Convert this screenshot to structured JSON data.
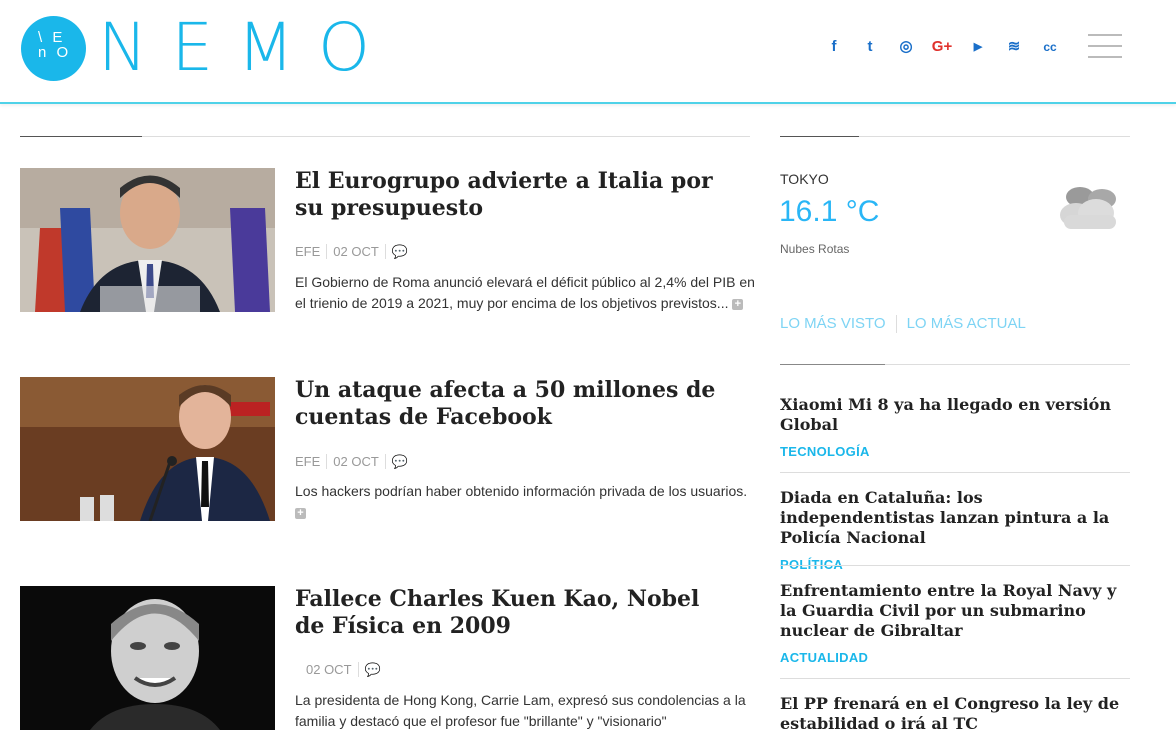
{
  "header": {
    "logo_mark": "\\ E\nn O",
    "logo_word": "NEMO",
    "social": [
      {
        "icon": "facebook-icon",
        "glyph": "f"
      },
      {
        "icon": "twitter-icon",
        "glyph": "t"
      },
      {
        "icon": "instagram-icon",
        "glyph": "◎"
      },
      {
        "icon": "google-plus-icon",
        "glyph": "G+"
      },
      {
        "icon": "youtube-icon",
        "glyph": "▶"
      },
      {
        "icon": "rss-icon",
        "glyph": "≋"
      },
      {
        "icon": "creative-commons-icon",
        "glyph": "cc"
      }
    ]
  },
  "articles": [
    {
      "title": "El Eurogrupo advierte a Italia por su presupuesto",
      "source": "EFE",
      "date": "02 OCT",
      "excerpt": "El Gobierno de Roma anunció elevará el déficit público al 2,4% del PIB en el trienio de 2019 a 2021, muy por encima de los objetivos previstos...",
      "more": "+"
    },
    {
      "title": "Un ataque afecta a 50 millones de cuentas de Facebook",
      "source": "EFE",
      "date": "02 OCT",
      "excerpt": "Los hackers podrían haber obtenido información privada de los usuarios.",
      "more": "+"
    },
    {
      "title": "Fallece Charles Kuen Kao, Nobel de Física en 2009",
      "source": "",
      "date": "02 OCT",
      "excerpt": "La presidenta de Hong Kong, Carrie Lam, expresó sus condolencias a la familia y destacó que el profesor fue \"brillante\" y \"visionario\"",
      "more": "+"
    }
  ],
  "weather": {
    "city": "TOKYO",
    "temp": "16.1 °C",
    "desc": "Nubes Rotas",
    "icon": "cloud-icon"
  },
  "tabs": [
    "LO MÁS VISTO",
    "LO MÁS ACTUAL"
  ],
  "sidebar": [
    {
      "title": "Xiaomi Mi 8 ya ha llegado en versión Global",
      "category": "TECNOLOGÍA"
    },
    {
      "title": "Diada en Cataluña: los independentistas lanzan pintura a la Policía Nacional",
      "category": "POLÍTICA"
    },
    {
      "title": "Enfrentamiento entre la Royal Navy y la Guardia Civil por un submarino nuclear de Gibraltar",
      "category": "ACTUALIDAD"
    },
    {
      "title": "El PP frenará en el Congreso la ley de estabilidad o irá al TC",
      "category": ""
    }
  ],
  "colors": {
    "accent": "#1ab7ea",
    "social": "#1a6fc9",
    "rule": "#4fd2e8"
  }
}
